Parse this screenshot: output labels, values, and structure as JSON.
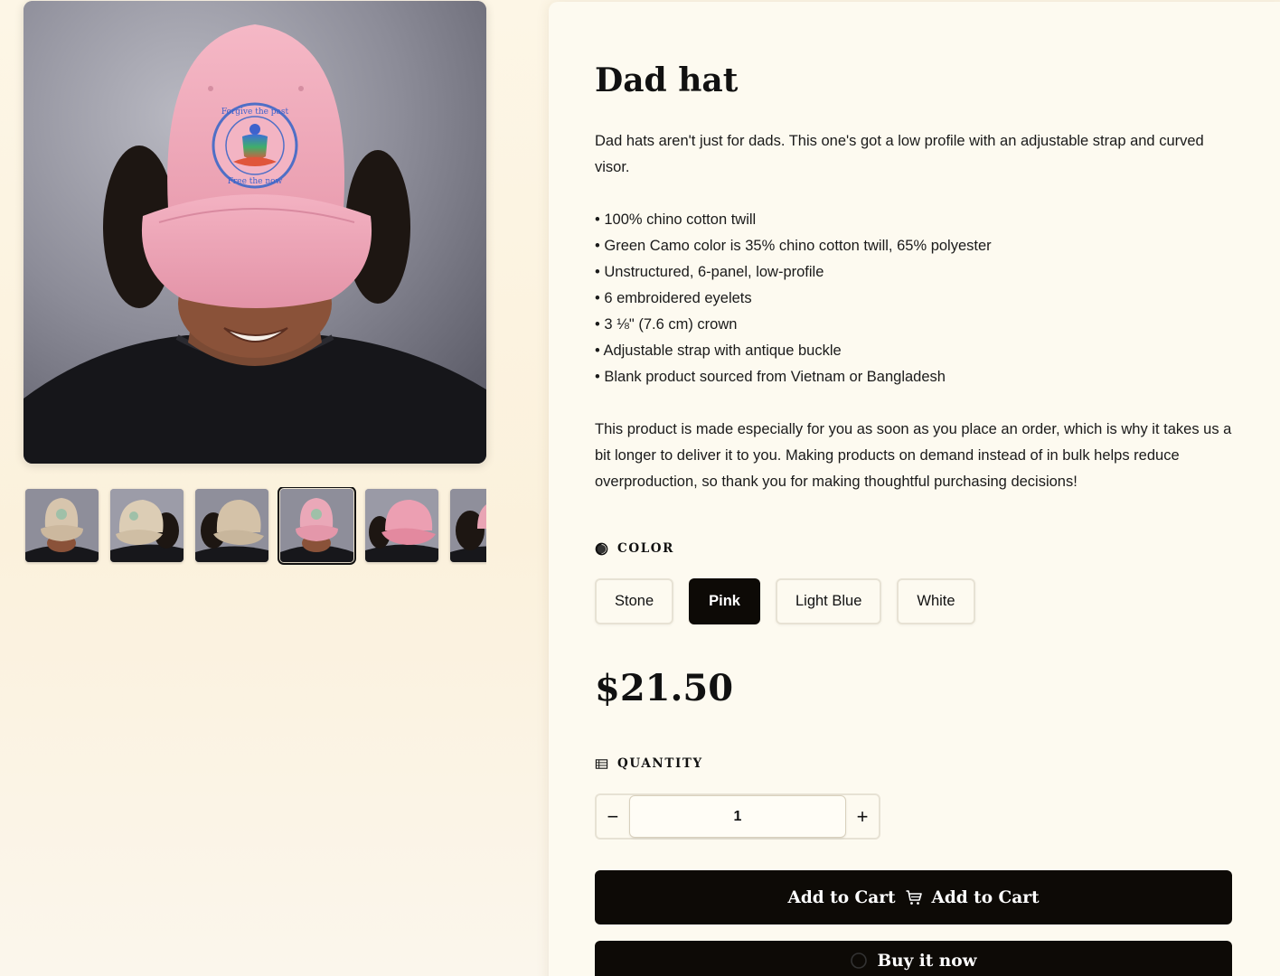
{
  "product": {
    "title": "Dad hat",
    "description": [
      "Dad hats aren't just for dads. This one's got a low profile with an adjustable strap and curved visor."
    ],
    "features": [
      "• 100% chino cotton twill",
      "• Green Camo color is 35% chino cotton twill, 65% polyester",
      "• Unstructured, 6-panel, low-profile",
      "• 6 embroidered eyelets",
      "• 3 ⅛\" (7.6 cm) crown",
      "• Adjustable strap with antique buckle",
      "• Blank product sourced from Vietnam or Bangladesh"
    ],
    "note": "This product is made especially for you as soon as you place an order, which is why it takes us a bit longer to deliver it to you. Making products on demand instead of in bulk helps reduce overproduction, so thank you for making thoughtful purchasing decisions!",
    "price": "$21.50"
  },
  "color": {
    "label": "COLOR",
    "icon": "half-circle-icon",
    "options": [
      "Stone",
      "Pink",
      "Light Blue",
      "White"
    ],
    "selected": "Pink"
  },
  "quantity": {
    "label": "QUANTITY",
    "icon": "table-icon",
    "value": "1",
    "decrement": "−",
    "increment": "+"
  },
  "buttons": {
    "add_to_cart_left": "Add to Cart",
    "add_to_cart_right": "Add to Cart",
    "buy_now": "Buy it now"
  },
  "gallery": {
    "emblem_top_text": "Forgive the past",
    "emblem_bottom_text": "Free the now",
    "thumbnails": [
      {
        "color": "Stone",
        "hat_hex": "#d7c5ad"
      },
      {
        "color": "Stone",
        "hat_hex": "#dccdb5"
      },
      {
        "color": "Stone",
        "hat_hex": "#d4c2a8"
      },
      {
        "color": "Pink",
        "hat_hex": "#eaa8b8",
        "active": true
      },
      {
        "color": "Pink",
        "hat_hex": "#ec9fb2"
      },
      {
        "color": "Pink",
        "hat_hex": "#e9a4b4"
      }
    ]
  },
  "colors": {
    "accent": "#0d0a06",
    "hat_pink": "#f0a8b8",
    "panel_bg": "#fdfaf0"
  }
}
